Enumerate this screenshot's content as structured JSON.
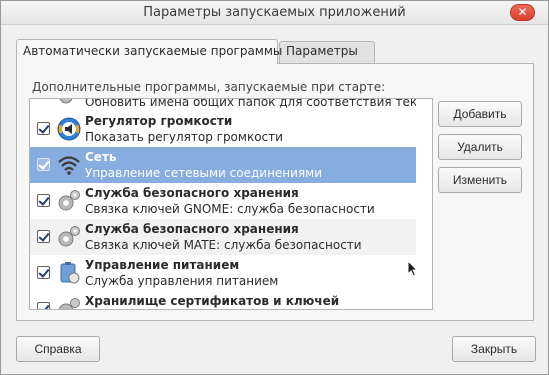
{
  "window": {
    "title": "Параметры запускаемых приложений",
    "close_glyph": "✕"
  },
  "tabs": [
    {
      "label": "Автоматически запускаемые программы",
      "active": true
    },
    {
      "label": "Параметры",
      "active": false
    }
  ],
  "startup": {
    "section_label": "Дополнительные программы, запускаемые при старте:",
    "partial_top_desc": "Обновить имена общих папок для соответствия тек...",
    "items": [
      {
        "title": "Регулятор громкости",
        "description": "Показать регулятор громкости",
        "checked": true,
        "icon": "volume-icon"
      },
      {
        "title": "Сеть",
        "description": "Управление сетевыми соединениями",
        "checked": true,
        "icon": "wifi-icon",
        "selected": true
      },
      {
        "title": "Служба безопасного хранения",
        "description": "Связка ключей GNOME: служба безопасности",
        "checked": true,
        "icon": "gears-icon"
      },
      {
        "title": "Служба безопасного хранения",
        "description": "Связка ключей MATE: служба безопасности",
        "checked": true,
        "icon": "gears-icon"
      },
      {
        "title": "Управление питанием",
        "description": "Служба управления питанием",
        "checked": true,
        "icon": "power-icon"
      },
      {
        "title": "Хранилище сертификатов и ключей",
        "description": "",
        "checked": true,
        "icon": "gears-icon"
      }
    ]
  },
  "side_buttons": {
    "add": "Добавить",
    "remove": "Удалить",
    "edit": "Изменить"
  },
  "bottom_buttons": {
    "help": "Справка",
    "close": "Закрыть"
  },
  "colors": {
    "selection": "#86ace0",
    "close_button": "#d8402f"
  }
}
